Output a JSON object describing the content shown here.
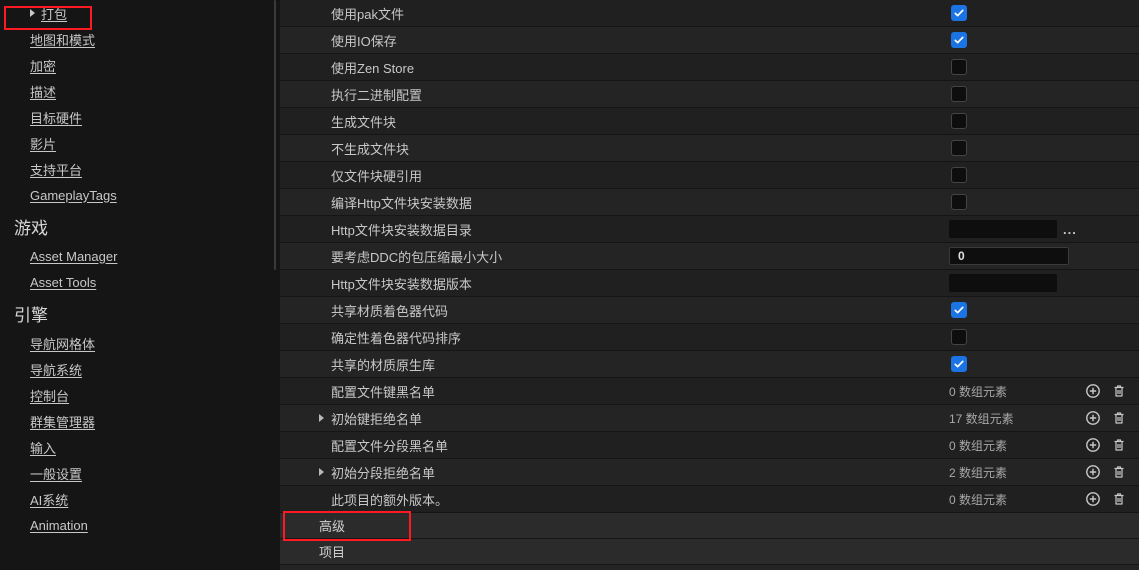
{
  "sidebar": {
    "groups": [
      {
        "title": null,
        "items": [
          {
            "label": "打包",
            "arrow": true,
            "selected": true
          },
          {
            "label": "地图和模式"
          },
          {
            "label": "加密"
          },
          {
            "label": "描述"
          },
          {
            "label": "目标硬件"
          },
          {
            "label": "影片"
          },
          {
            "label": "支持平台"
          },
          {
            "label": "GameplayTags"
          }
        ]
      },
      {
        "title": "游戏",
        "items": [
          {
            "label": "Asset Manager"
          },
          {
            "label": "Asset Tools"
          }
        ]
      },
      {
        "title": "引擎",
        "items": [
          {
            "label": "导航网格体"
          },
          {
            "label": "导航系统"
          },
          {
            "label": "控制台"
          },
          {
            "label": "群集管理器"
          },
          {
            "label": "输入"
          },
          {
            "label": "一般设置"
          },
          {
            "label": "AI系统"
          },
          {
            "label": "Animation"
          }
        ]
      }
    ]
  },
  "settings_rows": [
    {
      "label": "使用pak文件",
      "type": "checkbox",
      "checked": true
    },
    {
      "label": "使用IO保存",
      "type": "checkbox",
      "checked": true
    },
    {
      "label": "使用Zen Store",
      "type": "checkbox",
      "checked": false
    },
    {
      "label": "执行二进制配置",
      "type": "checkbox",
      "checked": false
    },
    {
      "label": "生成文件块",
      "type": "checkbox",
      "checked": false
    },
    {
      "label": "不生成文件块",
      "type": "checkbox",
      "checked": false
    },
    {
      "label": "仅文件块硬引用",
      "type": "checkbox",
      "checked": false
    },
    {
      "label": "编译Http文件块安装数据",
      "type": "checkbox",
      "checked": false
    },
    {
      "label": "Http文件块安装数据目录",
      "type": "text",
      "value": "",
      "browse": true
    },
    {
      "label": "要考虑DDC的包压缩最小大小",
      "type": "number",
      "value": "0"
    },
    {
      "label": "Http文件块安装数据版本",
      "type": "text",
      "value": ""
    },
    {
      "label": "共享材质着色器代码",
      "type": "checkbox",
      "checked": true
    },
    {
      "label": "确定性着色器代码排序",
      "type": "checkbox",
      "checked": false
    },
    {
      "label": "共享的材质原生库",
      "type": "checkbox",
      "checked": true
    },
    {
      "label": "配置文件键黑名单",
      "type": "array",
      "count": 0
    },
    {
      "label": "初始键拒绝名单",
      "type": "array",
      "count": 17,
      "expandable": true
    },
    {
      "label": "配置文件分段黑名单",
      "type": "array",
      "count": 0
    },
    {
      "label": "初始分段拒绝名单",
      "type": "array",
      "count": 2,
      "expandable": true
    },
    {
      "label": "此项目的额外版本。",
      "type": "array",
      "count": 0
    }
  ],
  "array_suffix": " 数组元素",
  "sections": [
    {
      "label": "高级",
      "expanded": false
    },
    {
      "label": "项目",
      "expanded": true
    }
  ]
}
